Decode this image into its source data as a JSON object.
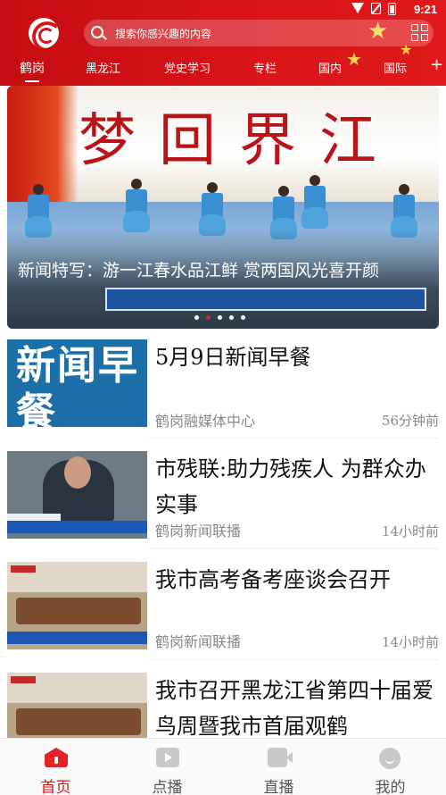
{
  "status_bar": {
    "time": "9:21"
  },
  "header": {
    "search_placeholder": "搜索你感兴趣的内容",
    "tabs": [
      {
        "label": "鹤岗",
        "active": true
      },
      {
        "label": "黑龙江",
        "active": false
      },
      {
        "label": "党史学习",
        "active": false
      },
      {
        "label": "专栏",
        "active": false
      },
      {
        "label": "国内",
        "active": false
      },
      {
        "label": "国际",
        "active": false
      }
    ],
    "more_tabs_symbol": "+"
  },
  "banner": {
    "calligraphy": "梦回界江",
    "caption": "新闻特写：游一江春水品江鲜 赏两国风光喜开颜",
    "slide_count": 5,
    "active_slide": 2
  },
  "news": [
    {
      "title": "5月9日新闻早餐",
      "source": "鹤岗融媒体中心",
      "time": "56分钟前",
      "thumb_text": "新闻早餐"
    },
    {
      "title": "市残联:助力残疾人 为群众办实事",
      "source": "鹤岗新闻联播",
      "time": "14小时前"
    },
    {
      "title": "我市高考备考座谈会召开",
      "source": "鹤岗新闻联播",
      "time": "14小时前"
    },
    {
      "title": "我市召开黑龙江省第四十届爱鸟周暨我市首届观鹤",
      "source": "",
      "time": ""
    }
  ],
  "bottom_nav": [
    {
      "label": "首页",
      "icon": "home-icon",
      "active": true
    },
    {
      "label": "点播",
      "icon": "tv-icon",
      "active": false
    },
    {
      "label": "直播",
      "icon": "camera-icon",
      "active": false
    },
    {
      "label": "我的",
      "icon": "profile-icon",
      "active": false
    }
  ],
  "colors": {
    "brand_red": "#d6161c",
    "active_dot": "#e0242a",
    "text_gray": "#888888"
  }
}
